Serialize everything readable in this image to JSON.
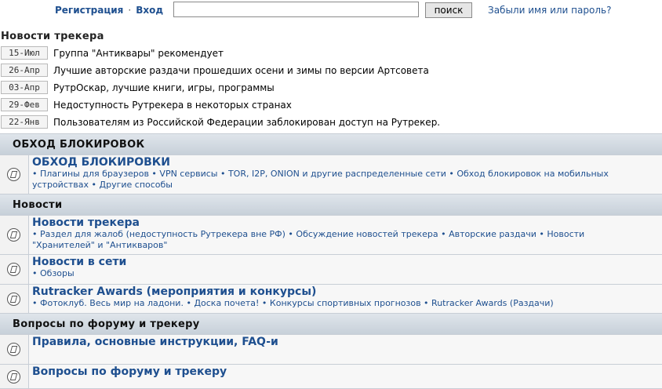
{
  "top": {
    "register": "Регистрация",
    "separator": "·",
    "login": "Вход",
    "search_value": "",
    "search_button": "поиск",
    "forgot": "Забыли имя или пароль?"
  },
  "news": {
    "title": "Новости трекера",
    "items": [
      {
        "date": "15-Июл",
        "text": "Группа \"Антиквары\" рекомендует"
      },
      {
        "date": "26-Апр",
        "text": "Лучшие авторские раздачи прошедших осени и зимы по версии Артсовета"
      },
      {
        "date": "03-Апр",
        "text": "РутрОскар, лучшие книги, игры, программы"
      },
      {
        "date": "29-Фев",
        "text": "Недоступность Рутрекера в некоторых странах"
      },
      {
        "date": "22-Янв",
        "text": "Пользователям из Российской Федерации заблокирован доступ на Рутрекер."
      }
    ]
  },
  "categories": [
    {
      "title": "ОБХОД БЛОКИРОВОК",
      "forums": [
        {
          "title": "ОБХОД БЛОКИРОВКИ",
          "subs": [
            "Плагины для браузеров",
            "VPN сервисы",
            "TOR, I2P, ONION и другие распределенные сети",
            "Обход блокировок на мобильных устройствах",
            "Другие способы"
          ]
        }
      ]
    },
    {
      "title": "Новости",
      "forums": [
        {
          "title": "Новости трекера",
          "subs": [
            "Раздел для жалоб (недоступность Рутрекера вне РФ)",
            "Обсуждение новостей трекера",
            "Авторские раздачи",
            "Новости \"Хранителей\" и \"Антикваров\""
          ]
        },
        {
          "title": "Новости в сети",
          "subs": [
            "Обзоры"
          ]
        },
        {
          "title": "Rutracker Awards (мероприятия и конкурсы)",
          "subs": [
            "Фотоклуб. Весь мир на ладони.",
            "Доска почета!",
            "Конкурсы спортивных прогнозов",
            "Rutracker Awards (Раздачи)"
          ]
        }
      ]
    },
    {
      "title": "Вопросы по форуму и трекеру",
      "forums": [
        {
          "title": "Правила, основные инструкции, FAQ-и",
          "subs": []
        },
        {
          "title": "Вопросы по форуму и трекеру",
          "subs": []
        }
      ]
    }
  ]
}
